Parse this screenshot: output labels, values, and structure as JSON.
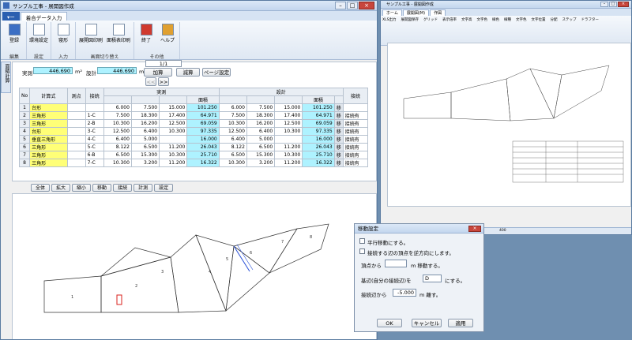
{
  "main": {
    "title": "サンプル工事 - 展開図作成",
    "ribbon_tab": "着合データ入力",
    "groups": [
      {
        "label": "編集",
        "buttons": [
          "登録"
        ]
      },
      {
        "label": "設定",
        "buttons": [
          "環境設定"
        ]
      },
      {
        "label": "入力",
        "buttons": [
          "寝形"
        ]
      },
      {
        "label": "画面切り替え",
        "buttons": [
          "展開図印刷",
          "面積表印刷"
        ]
      },
      {
        "label": "その他",
        "buttons": [
          "終了",
          "ヘルプ"
        ]
      }
    ],
    "side_tab": "面積計算",
    "jissoku_label": "実測",
    "jissoku_value": "446.690",
    "sekkei_label": "設計",
    "sekkei_value": "446.690",
    "unit": "m²",
    "page": "1/1",
    "btn_add": "加算",
    "btn_sub": "減算",
    "btn_page_setup": "ページ設定",
    "nav_prev": "<<",
    "nav_next": ">>",
    "table": {
      "h_no": "No",
      "h_shiki": "計算式",
      "h_point": "測点",
      "h_conn": "接続",
      "h_jissoku": "実測",
      "h_sekkei": "設計",
      "h_area": "面積",
      "h_setsuzoku": "接続",
      "rows": [
        {
          "no": "1",
          "shiki": "台形",
          "point": "",
          "conn": "",
          "a": "6.000",
          "b": "7.500",
          "c": "15.000",
          "area": "101.250",
          "a2": "6.000",
          "b2": "7.500",
          "c2": "15.000",
          "area2": "101.250",
          "m": "移",
          "note": ""
        },
        {
          "no": "2",
          "shiki": "三角形",
          "point": "",
          "conn": "1-C",
          "a": "7.500",
          "b": "18.300",
          "c": "17.400",
          "area": "64.971",
          "a2": "7.500",
          "b2": "18.300",
          "c2": "17.400",
          "area2": "64.971",
          "m": "移",
          "note": "接続有"
        },
        {
          "no": "3",
          "shiki": "三角形",
          "point": "",
          "conn": "2-B",
          "a": "10.300",
          "b": "16.200",
          "c": "12.500",
          "area": "69.059",
          "a2": "10.300",
          "b2": "16.200",
          "c2": "12.500",
          "area2": "69.059",
          "m": "移",
          "note": "接続有"
        },
        {
          "no": "4",
          "shiki": "台形",
          "point": "",
          "conn": "3-C",
          "a": "12.500",
          "b": "6.400",
          "c": "10.300",
          "area": "97.335",
          "a2": "12.500",
          "b2": "6.400",
          "c2": "10.300",
          "area2": "97.335",
          "m": "移",
          "note": "接続有"
        },
        {
          "no": "5",
          "shiki": "垂直三角形",
          "point": "",
          "conn": "4-C",
          "a": "6.400",
          "b": "5.000",
          "c": "",
          "area": "16.000",
          "a2": "6.400",
          "b2": "5.000",
          "c2": "",
          "area2": "16.000",
          "m": "移",
          "note": "接続有"
        },
        {
          "no": "6",
          "shiki": "三角形",
          "point": "",
          "conn": "5-C",
          "a": "8.122",
          "b": "6.500",
          "c": "11.200",
          "area": "26.043",
          "a2": "8.122",
          "b2": "6.500",
          "c2": "11.200",
          "area2": "26.043",
          "m": "移",
          "note": "接続有"
        },
        {
          "no": "7",
          "shiki": "三角形",
          "point": "",
          "conn": "6-B",
          "a": "6.500",
          "b": "15.300",
          "c": "10.300",
          "area": "25.710",
          "a2": "6.500",
          "b2": "15.300",
          "c2": "10.300",
          "area2": "25.710",
          "m": "移",
          "note": "接続有"
        },
        {
          "no": "8",
          "shiki": "三角形",
          "point": "",
          "conn": "7-C",
          "a": "10.300",
          "b": "3.200",
          "c": "11.200",
          "area": "16.322",
          "a2": "10.300",
          "b2": "3.200",
          "c2": "11.200",
          "area2": "16.322",
          "m": "移",
          "note": "接続有"
        }
      ]
    },
    "toolbar": [
      "全体",
      "拡大",
      "縮小",
      "移動",
      "接続",
      "計測",
      "設定"
    ]
  },
  "dialog": {
    "title": "移動設定",
    "opt1": "平行移動にする。",
    "opt2": "接続する辺の頂点を逆方向にします。",
    "vertex_pre": "頂点から",
    "vertex_val": "",
    "vertex_post": "m 移動する。",
    "base_pre": "基辺(自分の接続辺)を",
    "base_val": "D",
    "base_post": "にする。",
    "conn_pre": "接続辺から",
    "conn_val": "-5.000",
    "conn_post": "m 離す。",
    "ok": "OK",
    "cancel": "キャンセル",
    "apply": "適用"
  },
  "second": {
    "title": "サンプル工事 - 展開図作成",
    "tabs": [
      "ホーム",
      "展開図(M)",
      "作図"
    ],
    "ribbon_items": [
      "XLS出力",
      "展開図保存",
      "グリッド",
      "表示倍率",
      "文字高",
      "文字色",
      "線色",
      "線種",
      "文字色",
      "文字位置",
      "分配",
      "ステップ",
      "ドラフター"
    ],
    "group_labels": [
      "アンドゥ",
      "表示",
      "作図",
      "スタイル",
      "文字",
      "操作"
    ],
    "status": "400"
  }
}
